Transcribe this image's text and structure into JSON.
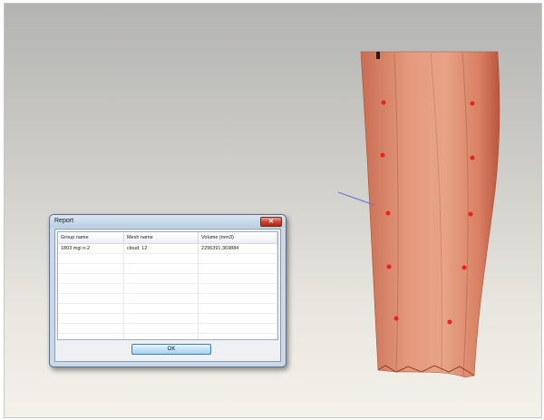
{
  "dialog": {
    "title": "Report",
    "close_glyph": "✕",
    "columns": [
      "Group name",
      "Mesh name",
      "Volume (mm3)"
    ],
    "rows": [
      [
        "1803 mgi n-2",
        "cloud: 12",
        "2296391.369884"
      ],
      [
        "",
        "",
        ""
      ],
      [
        "",
        "",
        ""
      ],
      [
        "",
        "",
        ""
      ],
      [
        "",
        "",
        ""
      ],
      [
        "",
        "",
        ""
      ],
      [
        "",
        "",
        ""
      ],
      [
        "",
        "",
        ""
      ],
      [
        "",
        "",
        ""
      ],
      [
        "",
        "",
        ""
      ]
    ],
    "ok_label": "OK"
  },
  "model": {
    "description_icon": "leg-mesh-icon",
    "skin_color": "#d9876d",
    "marker_color": "#e8241c",
    "pointer_line_color": "#6b6bd6"
  }
}
